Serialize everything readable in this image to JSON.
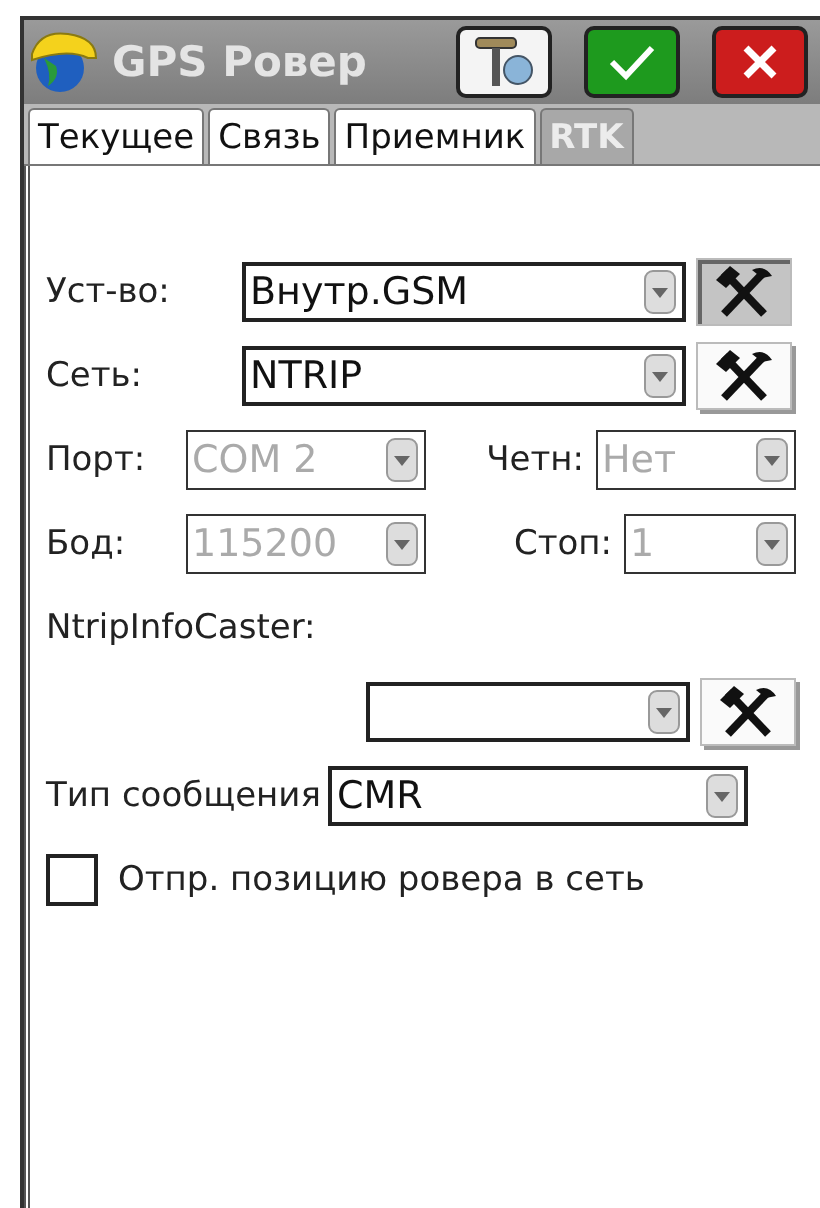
{
  "window": {
    "title": "GPS Ровер"
  },
  "title_buttons": [
    {
      "kind": "receiver"
    },
    {
      "kind": "ok"
    },
    {
      "kind": "close"
    }
  ],
  "tabs": [
    {
      "label": "Текущее",
      "selected": false
    },
    {
      "label": "Связь",
      "selected": false
    },
    {
      "label": "Приемник",
      "selected": false
    },
    {
      "label": "RTK",
      "selected": true
    }
  ],
  "rows": [
    {
      "kind": "combo",
      "label": "Уст-во:",
      "value": "Внутр.GSM",
      "tool_pressed": true
    },
    {
      "kind": "combo",
      "label": "Сеть:",
      "value": "NTRIP",
      "tool_pressed": false
    },
    {
      "kind": "pair",
      "items": [
        {
          "label": "Порт:",
          "value": "COM 2",
          "disabled": true
        },
        {
          "label": "Четн:",
          "value": "Нет",
          "disabled": true
        }
      ]
    },
    {
      "kind": "pair",
      "items": [
        {
          "label": "Бод:",
          "value": "115200",
          "disabled": true
        },
        {
          "label": "Стоп:",
          "value": "1",
          "disabled": true
        }
      ]
    },
    {
      "kind": "caption",
      "label": "NtripInfoCaster:"
    },
    {
      "kind": "combo",
      "tool_pressed": false
    },
    {
      "kind": "wide",
      "label": "Тип сообщения",
      "value": "CMR"
    },
    {
      "kind": "checkbox",
      "label": "Отпр. позицию ровера в сеть",
      "checked": false
    }
  ]
}
